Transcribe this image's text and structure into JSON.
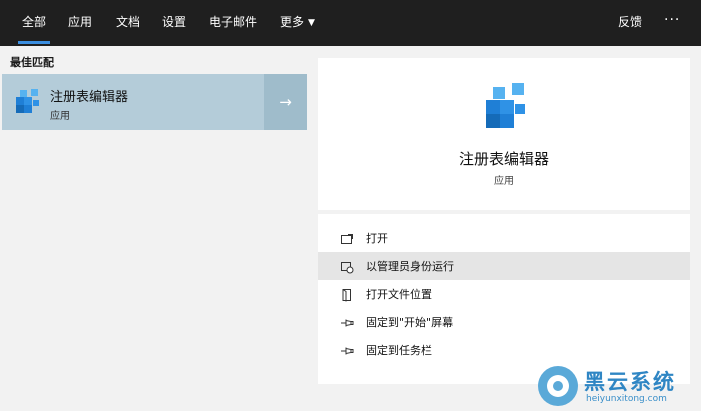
{
  "tabs": [
    {
      "label": "全部",
      "active": true
    },
    {
      "label": "应用"
    },
    {
      "label": "文档"
    },
    {
      "label": "设置"
    },
    {
      "label": "电子邮件"
    },
    {
      "label": "更多"
    }
  ],
  "topbar": {
    "feedback_label": "反馈",
    "more_options": "···",
    "more_caret": "▼"
  },
  "left": {
    "section_title": "最佳匹配",
    "best_match": {
      "name": "注册表编辑器",
      "type": "应用",
      "arrow": "→"
    }
  },
  "preview": {
    "title": "注册表编辑器",
    "subtitle": "应用"
  },
  "actions": [
    {
      "label": "打开",
      "icon": "open-icon"
    },
    {
      "label": "以管理员身份运行",
      "icon": "run-as-admin-icon"
    },
    {
      "label": "打开文件位置",
      "icon": "file-location-icon"
    },
    {
      "label": "固定到\"开始\"屏幕",
      "icon": "pin-icon"
    },
    {
      "label": "固定到任务栏",
      "icon": "pin-icon"
    }
  ],
  "watermark": {
    "name": "黑云系统",
    "url": "heiyunxitong.com"
  },
  "colors": {
    "topbar": "#1f1f1f",
    "accent": "#3b8ee0",
    "selected": "#b4ccd9",
    "icon_blue": "#1f7fd6"
  }
}
